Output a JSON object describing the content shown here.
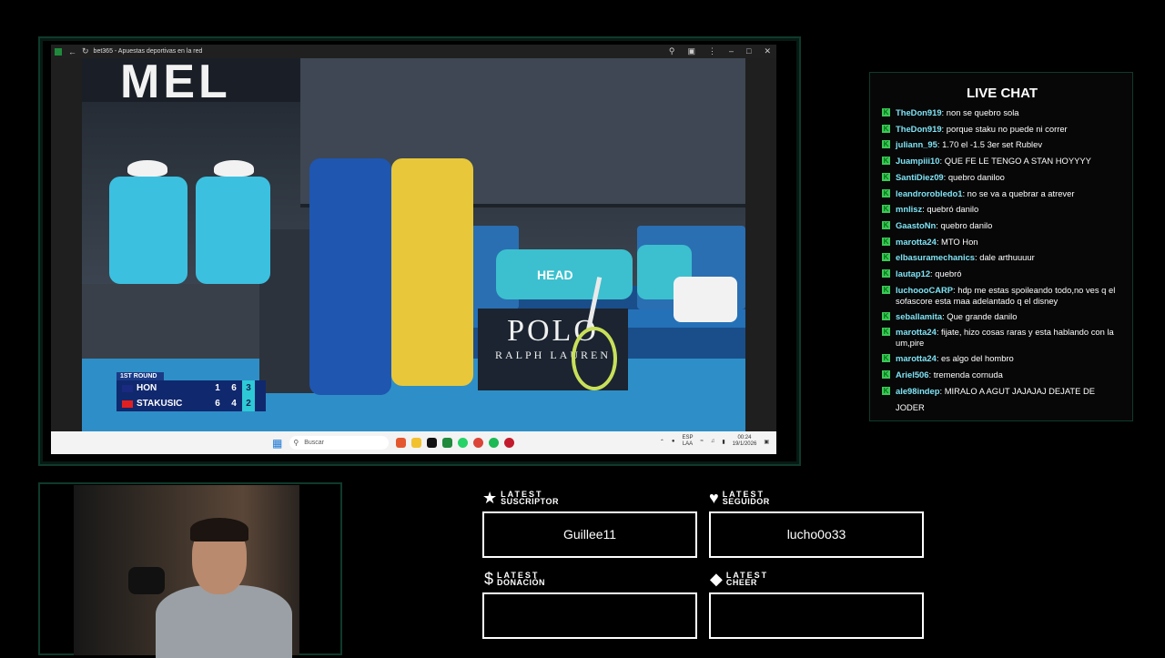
{
  "browser": {
    "title": "bet365 - Apuestas deportivas en la red"
  },
  "video": {
    "banner_text": "MEL",
    "bag_brand": "HEAD",
    "sponsor_line1": "POLO",
    "sponsor_line2": "RALPH LAUREN",
    "scoreboard": {
      "round": "1ST ROUND",
      "players": [
        {
          "name": "HON",
          "sets": [
            "1",
            "6"
          ],
          "current": "3"
        },
        {
          "name": "STAKUSIC",
          "sets": [
            "6",
            "4"
          ],
          "current": "2"
        }
      ]
    }
  },
  "taskbar": {
    "search_placeholder": "Buscar",
    "lang": "ESP",
    "layout": "LAA",
    "time": "00:24",
    "date": "19/1/2026"
  },
  "chat": {
    "title": "LIVE CHAT",
    "messages": [
      {
        "user": "TheDon919",
        "text": "non se quebro sola"
      },
      {
        "user": "TheDon919",
        "text": "porque staku no puede ni correr"
      },
      {
        "user": "juliann_95",
        "text": "1.70 el -1.5 3er set Rublev"
      },
      {
        "user": "Juampiii10",
        "text": "QUE FE LE TENGO A STAN HOYYYY"
      },
      {
        "user": "SantiDiez09",
        "text": "quebro daniloo"
      },
      {
        "user": "leandrorobledo1",
        "text": "no se va a quebrar a atrever"
      },
      {
        "user": "mnlisz",
        "text": "quebró danilo"
      },
      {
        "user": "GaastoNn",
        "text": "quebro danilo"
      },
      {
        "user": "marotta24",
        "text": "MTO Hon"
      },
      {
        "user": "elbasuramechanics",
        "text": "dale arthuuuur"
      },
      {
        "user": "lautap12",
        "text": "quebró"
      },
      {
        "user": "luchoooCARP",
        "text": "hdp me estas spoileando todo,no ves q el sofascore esta maa adelantado q el disney"
      },
      {
        "user": "seballamita",
        "text": "Que grande danilo"
      },
      {
        "user": "marotta24",
        "text": "fijate, hizo cosas raras y esta hablando con la um,pire"
      },
      {
        "user": "marotta24",
        "text": "es algo del hombro"
      },
      {
        "user": "Ariel506",
        "text": "tremenda cornuda"
      },
      {
        "user": "ale98indep",
        "text": "MIRALO A AGUT JAJAJAJ DEJATE DE JODER"
      }
    ]
  },
  "alerts": {
    "latest_word": "LATEST",
    "suscriptor": {
      "label": "SUSCRIPTOR",
      "value": "Guillee11",
      "icon": "star-icon"
    },
    "seguidor": {
      "label": "SEGUIDOR",
      "value": "lucho0o33",
      "icon": "heart-icon"
    },
    "donacion": {
      "label": "DONACIÓN",
      "value": "",
      "icon": "dollar-icon"
    },
    "cheer": {
      "label": "CHEER",
      "value": "",
      "icon": "diamond-icon"
    }
  }
}
